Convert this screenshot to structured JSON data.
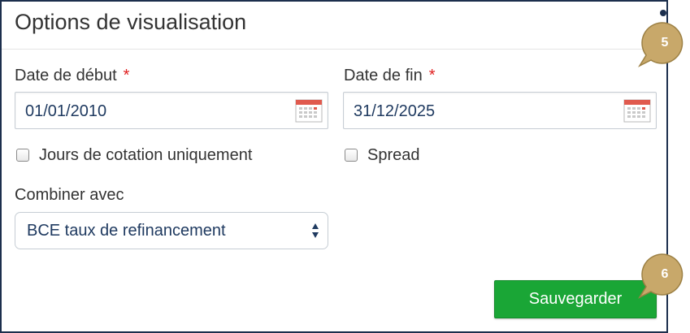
{
  "panel": {
    "title": "Options de visualisation"
  },
  "start_date": {
    "label": "Date de début",
    "required_mark": "*",
    "value": "01/01/2010",
    "icon": "calendar-icon"
  },
  "end_date": {
    "label": "Date de fin",
    "required_mark": "*",
    "value": "31/12/2025",
    "icon": "calendar-icon"
  },
  "options": {
    "trading_days_label": "Jours de cotation uniquement",
    "trading_days_checked": false,
    "spread_label": "Spread",
    "spread_checked": false
  },
  "combine": {
    "label": "Combiner avec",
    "selected": "BCE taux de refinancement",
    "icon": "select-arrows-icon"
  },
  "actions": {
    "save_label": "Sauvegarder"
  },
  "callouts": {
    "first": "5",
    "second": "6"
  },
  "colors": {
    "accent_green": "#1aa636",
    "callout_gold": "#c8a86a",
    "required_red": "#e02020",
    "value_navy": "#1f3a60",
    "frame_navy": "#1c2f4d"
  }
}
